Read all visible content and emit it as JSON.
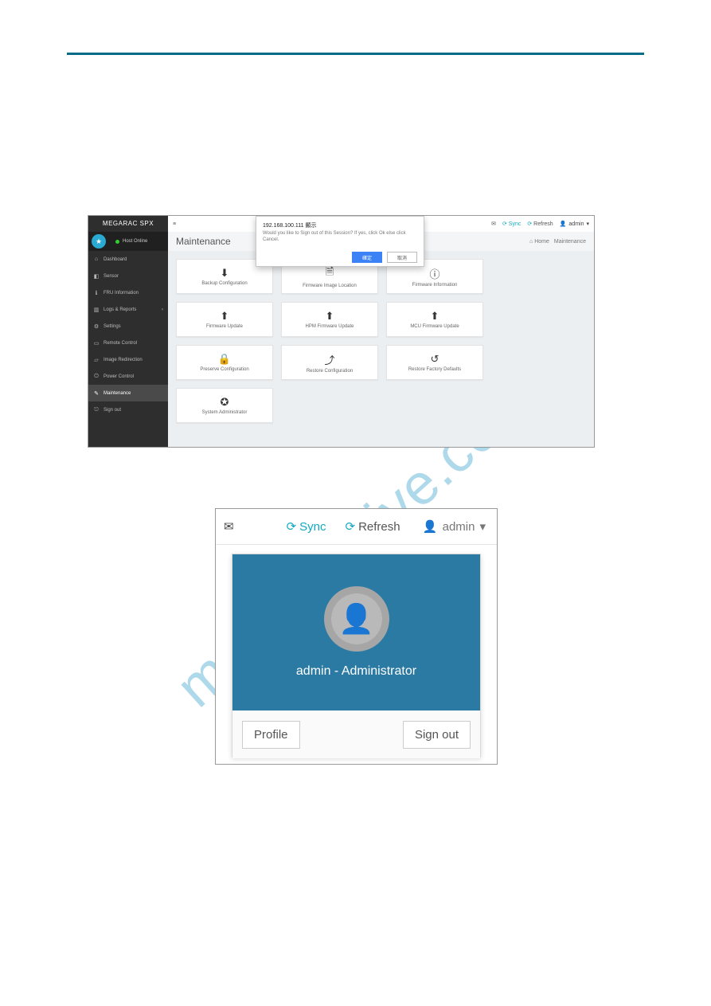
{
  "watermark": "manualshive.com",
  "shot1": {
    "brand": "MEGARAC SPX",
    "host_status": "Host Online",
    "sidebar": [
      {
        "icon": "home-icon",
        "label": "Dashboard"
      },
      {
        "icon": "dashboard-icon",
        "label": "Sensor"
      },
      {
        "icon": "info-icon",
        "label": "FRU Information"
      },
      {
        "icon": "chart-icon",
        "label": "Logs & Reports",
        "has_children": true
      },
      {
        "icon": "gear-icon",
        "label": "Settings"
      },
      {
        "icon": "display-icon",
        "label": "Remote Control"
      },
      {
        "icon": "image-icon",
        "label": "Image Redirection"
      },
      {
        "icon": "power-icon",
        "label": "Power Control"
      },
      {
        "icon": "wrench-icon",
        "label": "Maintenance",
        "active": true
      },
      {
        "icon": "signout-icon",
        "label": "Sign out"
      }
    ],
    "topbar": {
      "sync": "Sync",
      "refresh": "Refresh",
      "user": "admin"
    },
    "page_title": "Maintenance",
    "breadcrumbs": {
      "home": "Home",
      "current": "Maintenance"
    },
    "tiles": [
      {
        "icon": "download-icon",
        "label": "Backup Configuration"
      },
      {
        "icon": "file-icon",
        "label": "Firmware Image Location"
      },
      {
        "icon": "info-circle-icon",
        "label": "Firmware Information"
      },
      {
        "icon": "uparrow-box-icon",
        "label": "Firmware Update"
      },
      {
        "icon": "uparrow-box-icon",
        "label": "HPM Firmware Update"
      },
      {
        "icon": "uparrow-box-icon",
        "label": "MCU Firmware Update"
      },
      {
        "icon": "lock-icon",
        "label": "Preserve Configuration"
      },
      {
        "icon": "upload-icon",
        "label": "Restore Configuration"
      },
      {
        "icon": "undo-icon",
        "label": "Restore Factory Defaults"
      },
      {
        "icon": "badge-icon",
        "label": "System Administrator"
      }
    ],
    "dialog": {
      "title": "192.168.100.111 顯示",
      "text": "Would you like to Sign out of this Session? If yes, click Ok else click Cancel.",
      "ok": "確定",
      "cancel": "取消"
    }
  },
  "shot2": {
    "topbar": {
      "sync": "Sync",
      "refresh": "Refresh",
      "user": "admin"
    },
    "dropdown": {
      "title": "admin - Administrator",
      "profile": "Profile",
      "signout": "Sign out"
    }
  },
  "icon_glyphs": {
    "home-icon": "⌂",
    "dashboard-icon": "◧",
    "info-icon": "ℹ",
    "chart-icon": "▥",
    "gear-icon": "⚙",
    "display-icon": "▭",
    "image-icon": "▱",
    "power-icon": "⏻",
    "wrench-icon": "✎",
    "signout-icon": "⎋",
    "download-icon": "⬇",
    "file-icon": "🗎",
    "info-circle-icon": "ⓘ",
    "uparrow-box-icon": "⬆",
    "lock-icon": "🔒",
    "upload-icon": "⤴",
    "undo-icon": "↺",
    "badge-icon": "✪",
    "envelope-icon": "✉",
    "menu-icon": "≡",
    "sync-icon": "⟳",
    "refresh-icon": "⟳",
    "user-icon": "👤",
    "chevron-down-icon": "▾",
    "chevron-right-icon": "›",
    "star-icon": "★"
  }
}
